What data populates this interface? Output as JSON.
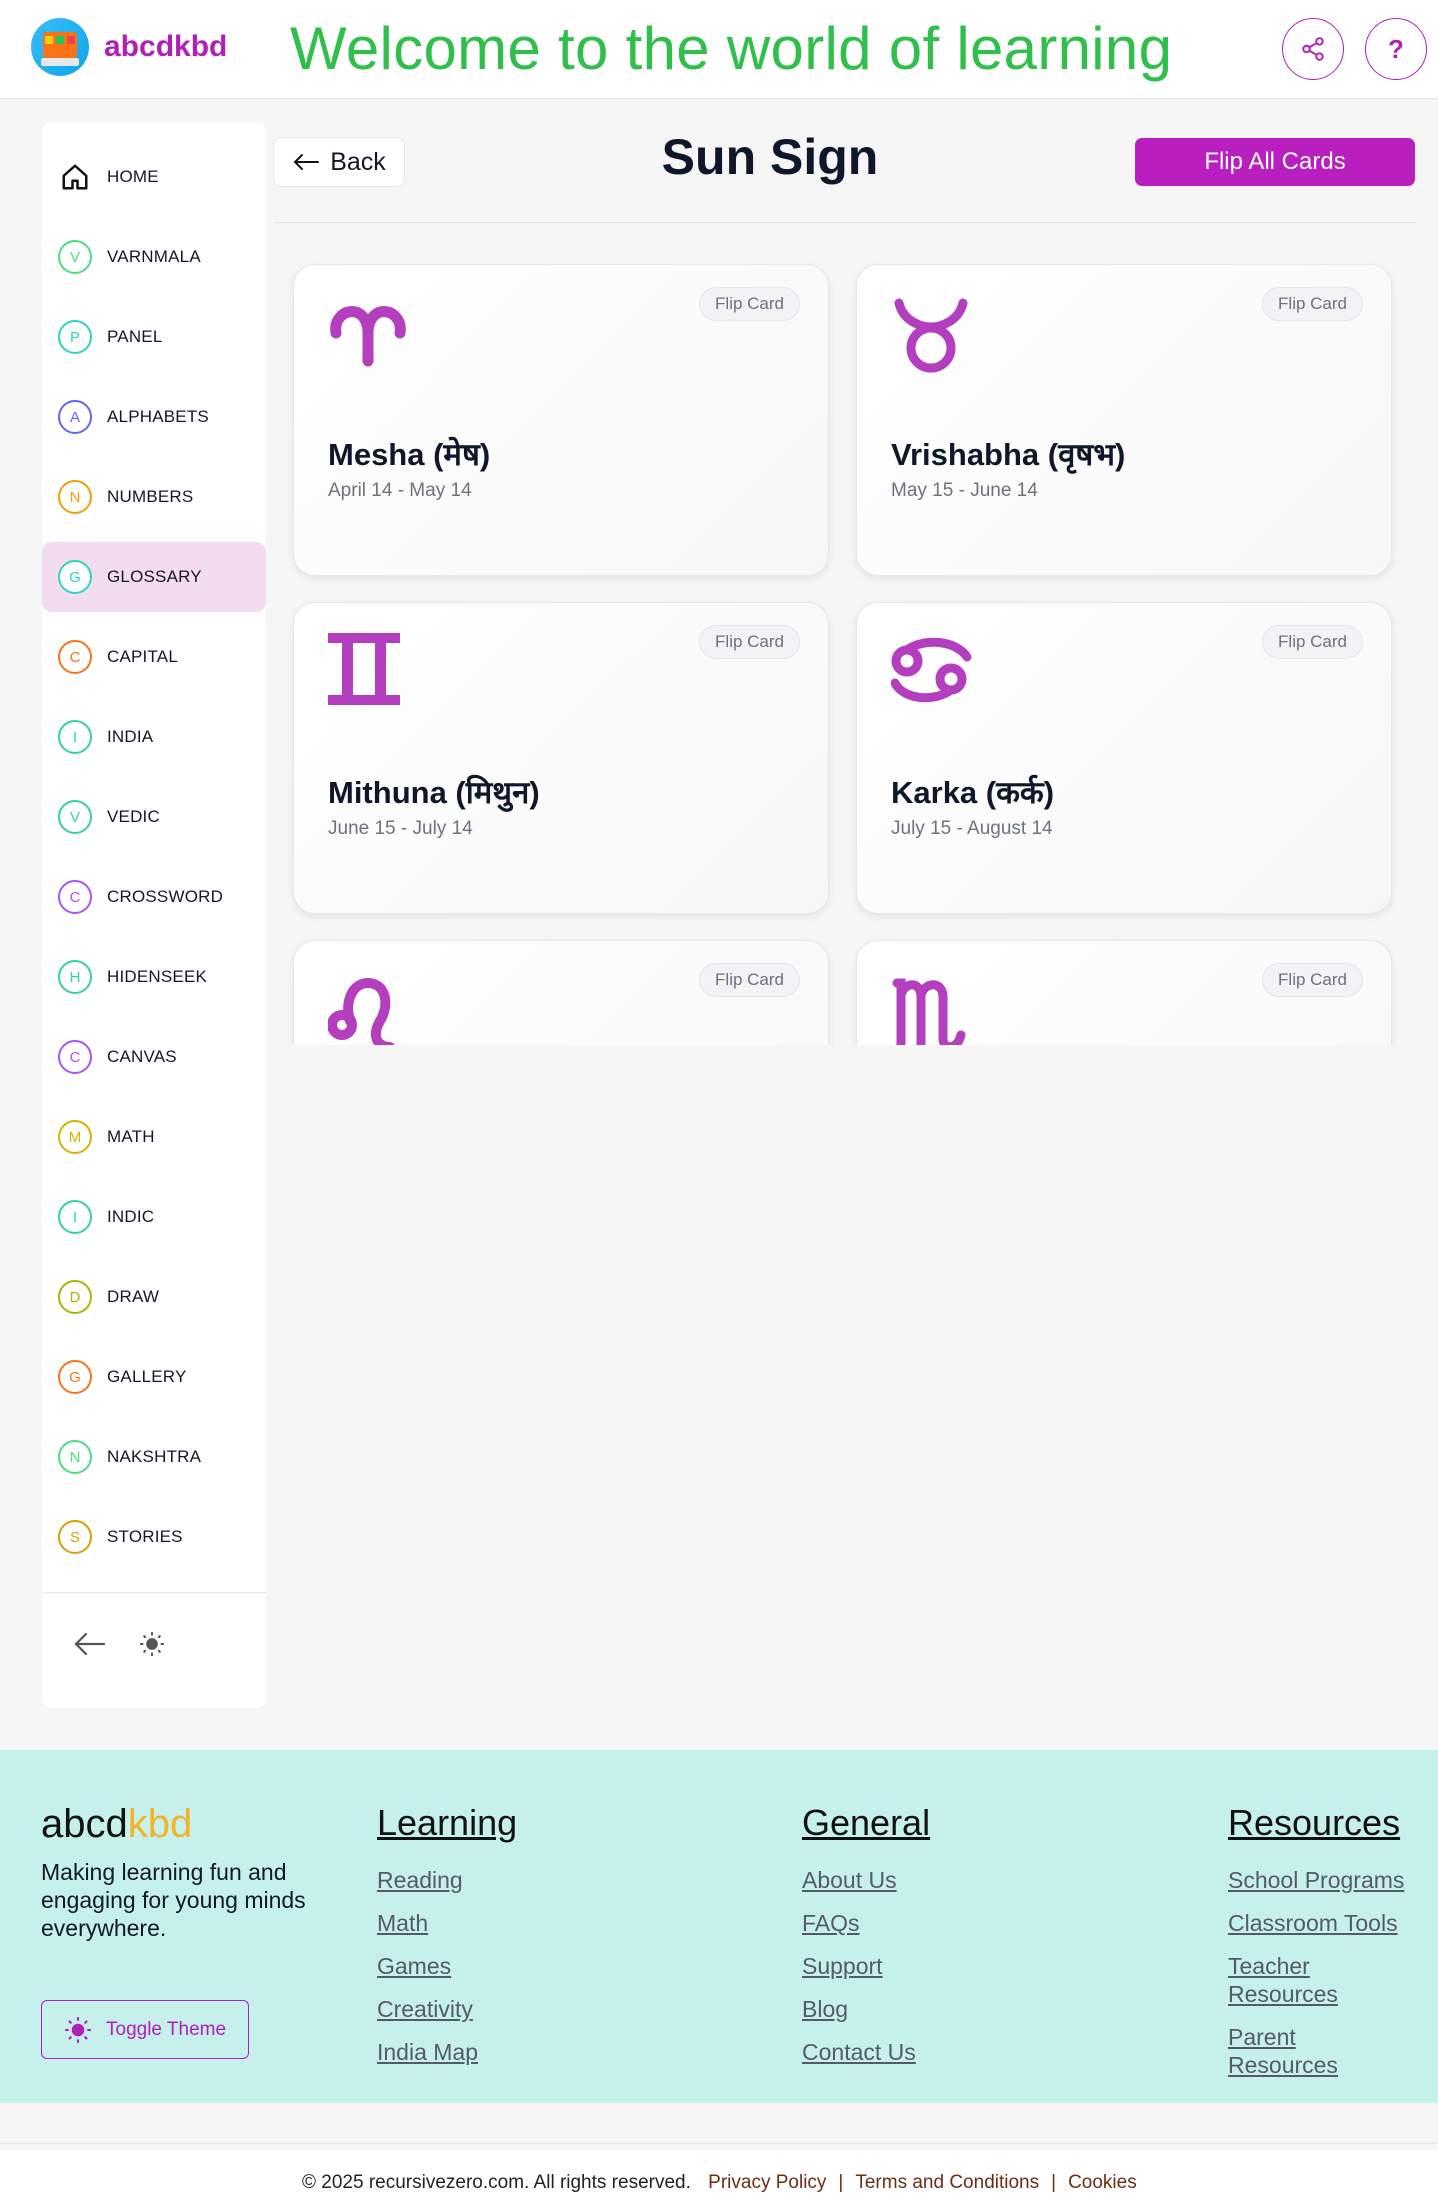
{
  "header": {
    "brand": "abcdkbd",
    "welcome": "Welcome to the world of learning",
    "help_label": "?",
    "accent_color": "#b020b8",
    "welcome_color": "#2fbf4a"
  },
  "sidebar": {
    "home_label": "HOME",
    "items": [
      {
        "letter": "V",
        "label": "VARNMALA",
        "color": "#4ade80"
      },
      {
        "letter": "P",
        "label": "PANEL",
        "color": "#2dd4bf"
      },
      {
        "letter": "A",
        "label": "ALPHABETS",
        "color": "#6366f1"
      },
      {
        "letter": "N",
        "label": "NUMBERS",
        "color": "#f59e0b"
      },
      {
        "letter": "G",
        "label": "GLOSSARY",
        "color": "#2dd4bf"
      },
      {
        "letter": "C",
        "label": "CAPITAL",
        "color": "#f97316"
      },
      {
        "letter": "I",
        "label": "INDIA",
        "color": "#34d399"
      },
      {
        "letter": "V",
        "label": "VEDIC",
        "color": "#34d399"
      },
      {
        "letter": "C",
        "label": "CROSSWORD",
        "color": "#a855f7"
      },
      {
        "letter": "H",
        "label": "HIDENSEEK",
        "color": "#34d399"
      },
      {
        "letter": "C",
        "label": "CANVAS",
        "color": "#a855f7"
      },
      {
        "letter": "M",
        "label": "MATH",
        "color": "#d4b106"
      },
      {
        "letter": "I",
        "label": "INDIC",
        "color": "#34d399"
      },
      {
        "letter": "D",
        "label": "DRAW",
        "color": "#a3b806"
      },
      {
        "letter": "G",
        "label": "GALLERY",
        "color": "#f97316"
      },
      {
        "letter": "N",
        "label": "NAKSHTRA",
        "color": "#4ade80"
      },
      {
        "letter": "S",
        "label": "STORIES",
        "color": "#d4a106"
      }
    ],
    "active_label": "GLOSSARY"
  },
  "main": {
    "back_label": "Back",
    "title": "Sun Sign",
    "flip_all_label": "Flip All Cards",
    "cards": [
      {
        "name": "Mesha (मेष)",
        "dates": "April 14 - May 14",
        "flip_label": "Flip Card",
        "icon": "aries-icon"
      },
      {
        "name": "Vrishabha (वृषभ)",
        "dates": "May 15 - June 14",
        "flip_label": "Flip Card",
        "icon": "taurus-icon"
      },
      {
        "name": "Mithuna (मिथुन)",
        "dates": "June 15 - July 14",
        "flip_label": "Flip Card",
        "icon": "gemini-icon"
      },
      {
        "name": "Karka (कर्क)",
        "dates": "July 15 - August 14",
        "flip_label": "Flip Card",
        "icon": "cancer-icon"
      },
      {
        "name": "",
        "dates": "",
        "flip_label": "Flip Card",
        "icon": "leo-icon"
      },
      {
        "name": "",
        "dates": "",
        "flip_label": "Flip Card",
        "icon": "virgo-icon"
      }
    ]
  },
  "footer": {
    "brand_a": "abcd",
    "brand_b": "kbd",
    "tagline": "Making learning fun and engaging for young minds everywhere.",
    "toggle_label": "Toggle Theme",
    "columns": [
      {
        "title": "Learning",
        "links": [
          "Reading",
          "Math",
          "Games",
          "Creativity",
          "India Map"
        ]
      },
      {
        "title": "General",
        "links": [
          "About Us",
          "FAQs",
          "Support",
          "Blog",
          "Contact Us"
        ]
      },
      {
        "title": "Resources",
        "links": [
          "School Programs",
          "Classroom Tools",
          "Teacher Resources",
          "Parent Resources"
        ]
      }
    ],
    "copyright": "© 2025 recursivezero.com. All rights reserved.",
    "legal_links": [
      "Privacy Policy",
      "Terms and Conditions",
      "Cookies"
    ],
    "background_color": "#c6f0ec"
  }
}
